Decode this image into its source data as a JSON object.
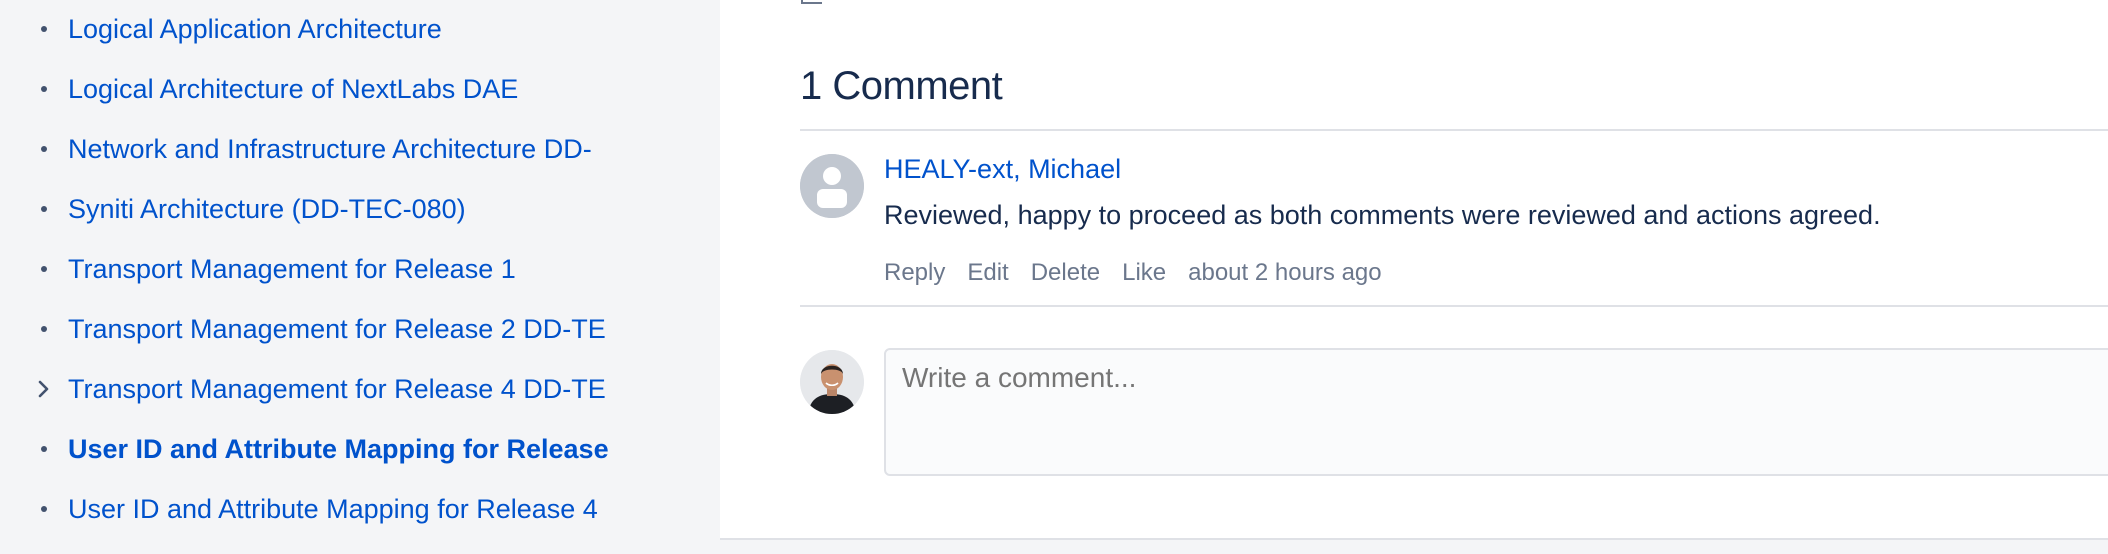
{
  "sidebar": {
    "items": [
      {
        "label": "Logical Application Architecture",
        "marker": "bullet",
        "active": false
      },
      {
        "label": "Logical Architecture of NextLabs DAE",
        "marker": "bullet",
        "active": false
      },
      {
        "label": "Network and Infrastructure Architecture DD-",
        "marker": "bullet",
        "active": false
      },
      {
        "label": "Syniti Architecture (DD-TEC-080)",
        "marker": "bullet",
        "active": false
      },
      {
        "label": "Transport Management for Release 1",
        "marker": "bullet",
        "active": false
      },
      {
        "label": "Transport Management for Release 2 DD-TE",
        "marker": "bullet",
        "active": false
      },
      {
        "label": "Transport Management for Release 4 DD-TE",
        "marker": "chevron-right-icon",
        "active": false
      },
      {
        "label": "User ID and Attribute Mapping for Release",
        "marker": "bullet",
        "active": true
      },
      {
        "label": "User ID and Attribute Mapping for Release 4",
        "marker": "bullet",
        "active": false
      }
    ]
  },
  "comments": {
    "heading": "1 Comment",
    "items": [
      {
        "author": "HEALY-ext, Michael",
        "body": "Reviewed, happy to proceed as both comments were reviewed and actions agreed.",
        "actions": {
          "reply": "Reply",
          "edit": "Edit",
          "delete": "Delete",
          "like": "Like"
        },
        "timestamp": "about 2 hours ago",
        "avatar_icon": "default-avatar-icon"
      }
    ],
    "editor": {
      "placeholder": "Write a comment..."
    }
  },
  "colors": {
    "link": "#0052cc",
    "text": "#172b4d",
    "muted": "#6b778c",
    "sidebar_bg": "#f4f5f7",
    "main_bg": "#ffffff",
    "divider": "#dfe1e6"
  }
}
